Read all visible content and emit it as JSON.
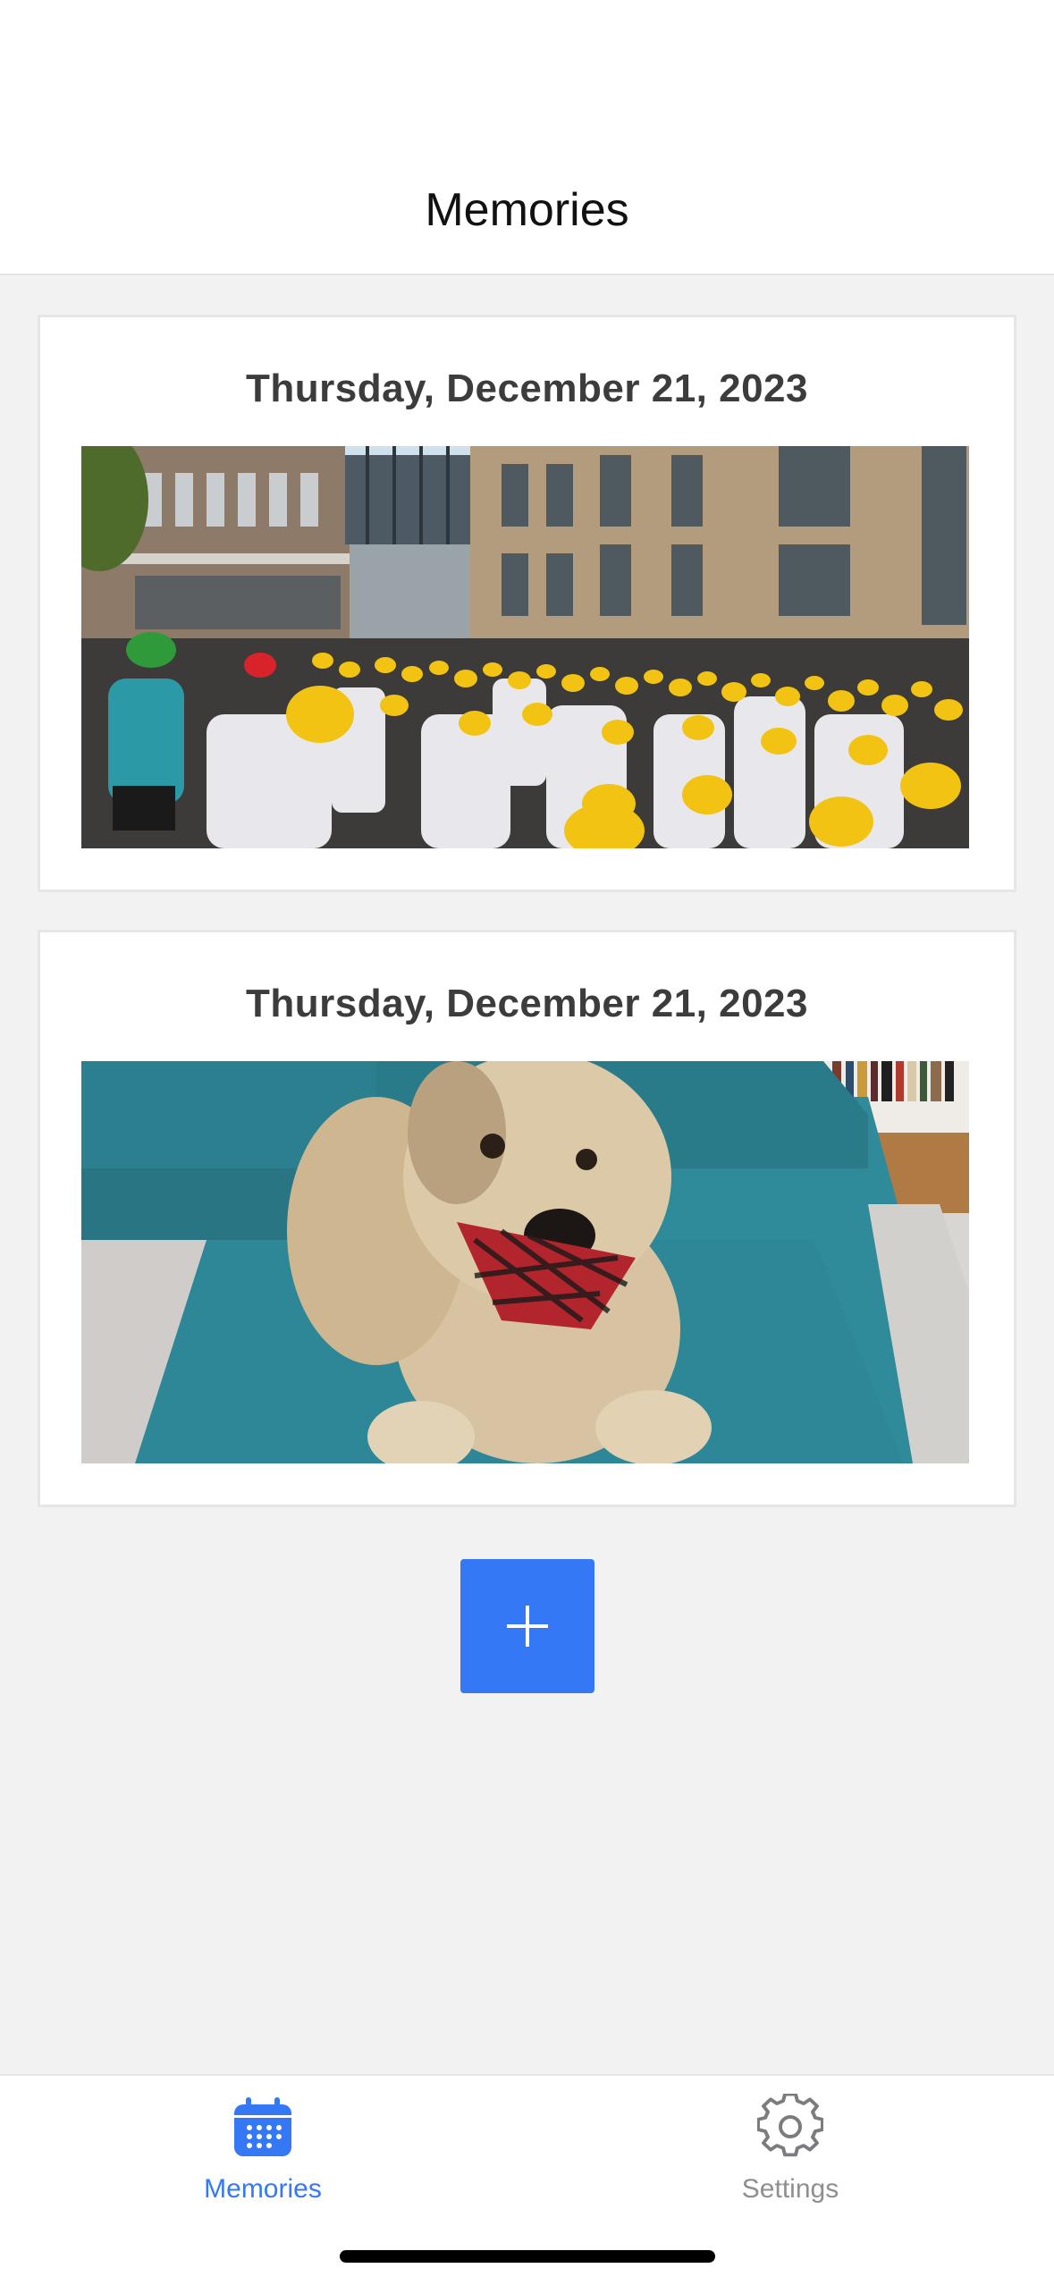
{
  "header": {
    "title": "Memories"
  },
  "memories": [
    {
      "date": "Thursday, December 21, 2023",
      "photo": "crowd of students in yellow hard hats in a courtyard"
    },
    {
      "date": "Thursday, December 21, 2023",
      "photo": "fluffy dog with red plaid bandana on teal couch"
    }
  ],
  "add_button": {
    "icon": "plus-icon"
  },
  "tabbar": {
    "tabs": [
      {
        "label": "Memories",
        "icon": "calendar-icon",
        "active": true
      },
      {
        "label": "Settings",
        "icon": "gear-icon",
        "active": false
      }
    ]
  },
  "colors": {
    "accent": "#3478f6",
    "inactive": "#8e8e93",
    "background": "#f2f2f2"
  }
}
